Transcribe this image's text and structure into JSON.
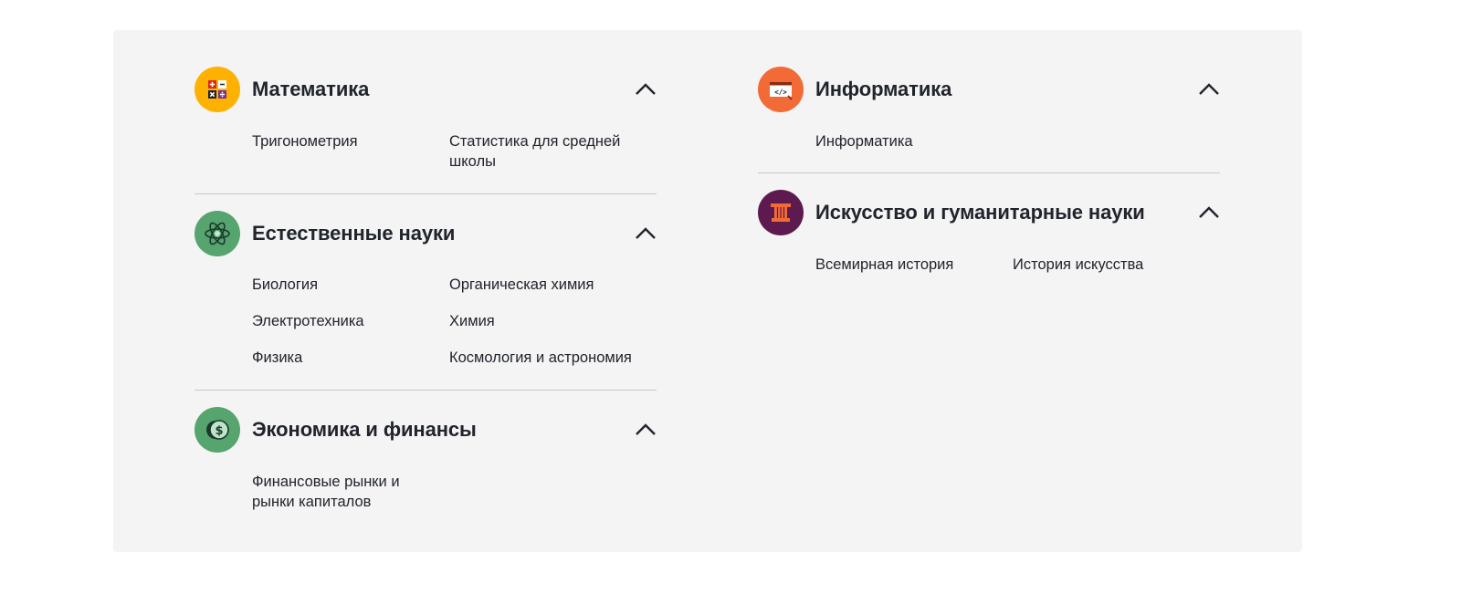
{
  "colors": {
    "panel_bg": "#f4f4f4",
    "math_icon": "#ffb100",
    "science_icon": "#56a46e",
    "economics_icon": "#56a46e",
    "computing_icon": "#f26b36",
    "arts_icon": "#5c1a4f",
    "divider": "#c8c8c8",
    "text": "#21242c"
  },
  "sections": {
    "math": {
      "title": "Математика",
      "icon": "calculator-icon",
      "links": [
        "Тригонометрия",
        "Статистика для средней школы"
      ]
    },
    "science": {
      "title": "Естественные науки",
      "icon": "atom-icon",
      "links": [
        "Биология",
        "Органическая химия",
        "Электротехника",
        "Химия",
        "Физика",
        "Космология и астрономия"
      ]
    },
    "economics": {
      "title": "Экономика и финансы",
      "icon": "dollar-coin-icon",
      "links": [
        "Финансовые рынки и рынки капиталов"
      ]
    },
    "computing": {
      "title": "Информатика",
      "icon": "code-window-icon",
      "links": [
        "Информатика"
      ]
    },
    "arts": {
      "title": "Искусство и гуманитарные науки",
      "icon": "column-icon",
      "links": [
        "Всемирная история",
        "История искусства"
      ]
    }
  }
}
